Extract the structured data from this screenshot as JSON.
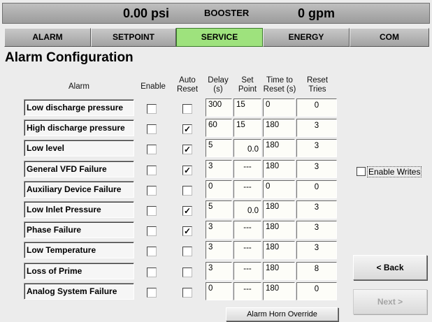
{
  "status": {
    "pressure": "0.00 psi",
    "mode": "BOOSTER",
    "flow": "0 gpm"
  },
  "tabs": [
    {
      "label": "ALARM",
      "active": false
    },
    {
      "label": "SETPOINT",
      "active": false
    },
    {
      "label": "SERVICE",
      "active": true
    },
    {
      "label": "ENERGY",
      "active": false
    },
    {
      "label": "COM",
      "active": false
    }
  ],
  "page_title": "Alarm Configuration",
  "headers": {
    "alarm": "Alarm",
    "enable": "Enable",
    "auto_reset": [
      "Auto",
      "Reset"
    ],
    "delay": [
      "Delay",
      "(s)"
    ],
    "set_point": [
      "Set",
      "Point"
    ],
    "time_to_reset": [
      "Time to",
      "Reset (s)"
    ],
    "reset_tries": [
      "Reset",
      "Tries"
    ]
  },
  "alarms": [
    {
      "name": "Low discharge pressure",
      "enable": false,
      "auto_reset": false,
      "delay": "300",
      "set_point": "15",
      "set_point_align": "left",
      "time_to_reset": "0",
      "reset_tries": "0"
    },
    {
      "name": "High discharge pressure",
      "enable": false,
      "auto_reset": true,
      "delay": "60",
      "set_point": "15",
      "set_point_align": "left",
      "time_to_reset": "180",
      "reset_tries": "3"
    },
    {
      "name": "Low level",
      "enable": false,
      "auto_reset": true,
      "delay": "5",
      "set_point": "0.0",
      "set_point_align": "right",
      "time_to_reset": "180",
      "reset_tries": "3"
    },
    {
      "name": "General VFD Failure",
      "enable": false,
      "auto_reset": true,
      "delay": "3",
      "set_point": "---",
      "set_point_align": "center",
      "time_to_reset": "180",
      "reset_tries": "3"
    },
    {
      "name": "Auxiliary Device Failure",
      "enable": false,
      "auto_reset": false,
      "delay": "0",
      "set_point": "---",
      "set_point_align": "center",
      "time_to_reset": "0",
      "reset_tries": "0"
    },
    {
      "name": "Low Inlet Pressure",
      "enable": false,
      "auto_reset": true,
      "delay": "5",
      "set_point": "0.0",
      "set_point_align": "right",
      "time_to_reset": "180",
      "reset_tries": "3"
    },
    {
      "name": "Phase Failure",
      "enable": false,
      "auto_reset": true,
      "delay": "3",
      "set_point": "---",
      "set_point_align": "center",
      "time_to_reset": "180",
      "reset_tries": "3"
    },
    {
      "name": "Low Temperature",
      "enable": false,
      "auto_reset": false,
      "delay": "3",
      "set_point": "---",
      "set_point_align": "center",
      "time_to_reset": "180",
      "reset_tries": "3"
    },
    {
      "name": "Loss of Prime",
      "enable": false,
      "auto_reset": false,
      "delay": "3",
      "set_point": "---",
      "set_point_align": "center",
      "time_to_reset": "180",
      "reset_tries": "8"
    },
    {
      "name": "Analog System Failure",
      "enable": false,
      "auto_reset": false,
      "delay": "0",
      "set_point": "---",
      "set_point_align": "center",
      "time_to_reset": "180",
      "reset_tries": "0"
    }
  ],
  "enable_writes": {
    "label": "Enable Writes",
    "checked": false
  },
  "buttons": {
    "back": "< Back",
    "next": "Next >",
    "horn_override": "Alarm Horn Override"
  },
  "colors": {
    "active_tab": "#9ee27d",
    "background": "#ececec"
  }
}
